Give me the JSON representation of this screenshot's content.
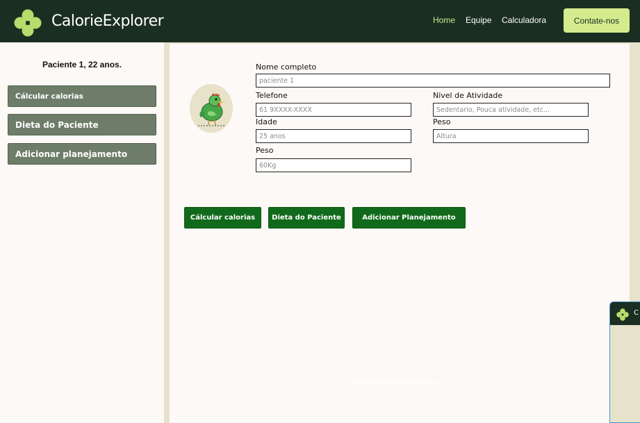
{
  "header": {
    "brand": "CalorieExplorer",
    "nav": [
      "Home",
      "Equipe",
      "Calculadora"
    ],
    "contact_label": "Contate-nos"
  },
  "sidebar": {
    "patient_title": "Paciente 1, 22 anos.",
    "buttons": [
      "Cálcular calorias",
      "Dieta do Paciente",
      "Adicionar planejamento"
    ]
  },
  "form": {
    "nome_label": "Nome completo",
    "nome_placeholder": "paciente 1",
    "telefone_label": "Telefone",
    "telefone_placeholder": "61 9XXXX-XXXX",
    "idade_label": "Idade",
    "idade_placeholder": "25 anos",
    "peso_label": "Peso",
    "peso_placeholder": "60Kg",
    "atividade_label": "Nivel de Atividade",
    "atividade_placeholder": "Sedentario, Pouca atividade, etc...",
    "peso2_label": "Peso",
    "altura_placeholder": "Altura"
  },
  "actions": [
    "Cálcular calorias",
    "Dieta do Paciente",
    "Adicionar Planejamento"
  ],
  "ghost_text": "Adicionar pacientes",
  "mini_window": {
    "title_fragment": "C"
  },
  "colors": {
    "header_bg": "#1b2e22",
    "accent": "#d4ec8e",
    "side_button": "#6d7d69",
    "action_button": "#116a1b",
    "page_bg": "#e6e2cc"
  },
  "icons": [
    "clover-logo-icon",
    "chicken-avatar-icon"
  ]
}
